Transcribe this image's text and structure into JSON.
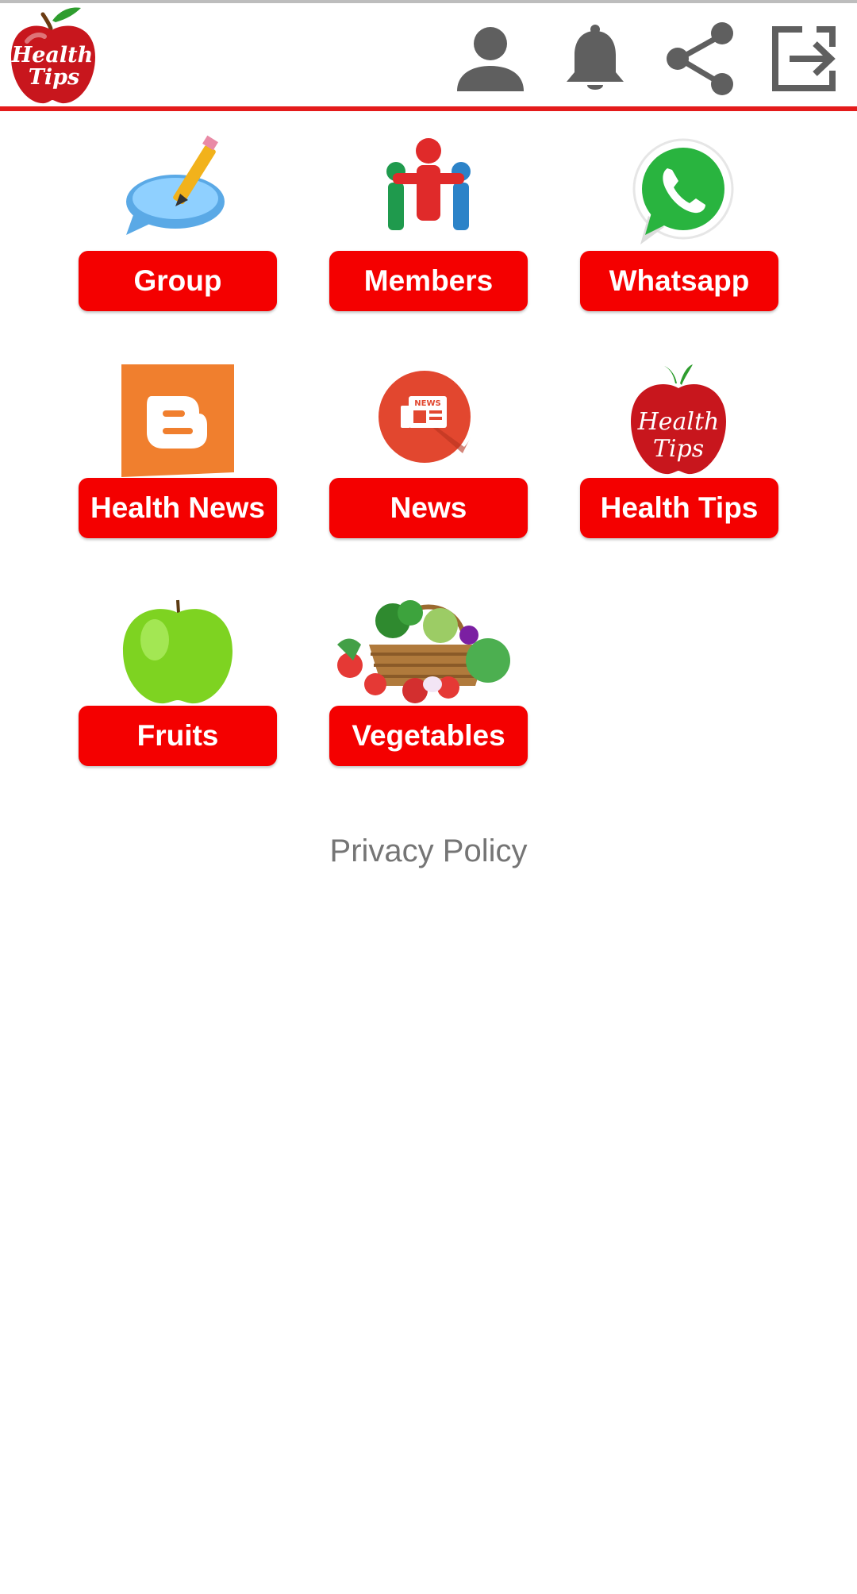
{
  "app": {
    "logo_text_line1": "Health",
    "logo_text_line2": "Tips"
  },
  "toolbar": {
    "actions": [
      {
        "icon": "person-icon",
        "name": "profile"
      },
      {
        "icon": "bell-icon",
        "name": "notifications"
      },
      {
        "icon": "share-icon",
        "name": "share"
      },
      {
        "icon": "logout-icon",
        "name": "exit"
      }
    ]
  },
  "grid": {
    "items": [
      {
        "label": "Group",
        "icon": "chat-pencil-icon"
      },
      {
        "label": "Members",
        "icon": "members-icon"
      },
      {
        "label": "Whatsapp",
        "icon": "whatsapp-icon"
      },
      {
        "label": "Health News",
        "icon": "blogger-icon"
      },
      {
        "label": "News",
        "icon": "newspaper-icon"
      },
      {
        "label": "Health Tips",
        "icon": "apple-logo-icon",
        "art_line1": "Health",
        "art_line2": "Tips",
        "art_text_is_logo": true
      },
      {
        "label": "Fruits",
        "icon": "green-apple-icon"
      },
      {
        "label": "Vegetables",
        "icon": "vegetable-basket-icon"
      }
    ]
  },
  "footer": {
    "privacy_label": "Privacy Policy"
  },
  "colors": {
    "accent": "#f40000",
    "divider": "#e41b1b",
    "icon_gray": "#5f5f5f",
    "link_gray": "#757575"
  }
}
